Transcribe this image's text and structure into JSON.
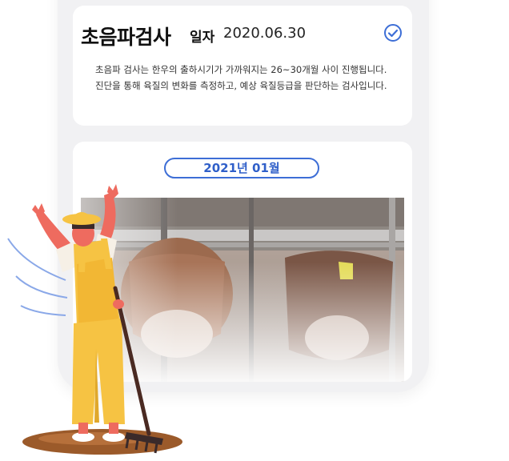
{
  "exam": {
    "title": "초음파검사",
    "date_label": "일자",
    "date_value": "2020.06.30",
    "description": "초음파 검사는 한우의 출하시기가 가까워지는 26~30개월 사이 진행됩니다. 진단을 통해 육질의 변화를 측정하고, 예상 육질등급을 판단하는 검사입니다.",
    "status_icon": "check-circle-icon"
  },
  "timeline": {
    "month_label": "2021년 01월"
  },
  "colors": {
    "accent": "#3d6ed6",
    "card_bg": "#ffffff",
    "page_bg": "#f1f1f3"
  }
}
